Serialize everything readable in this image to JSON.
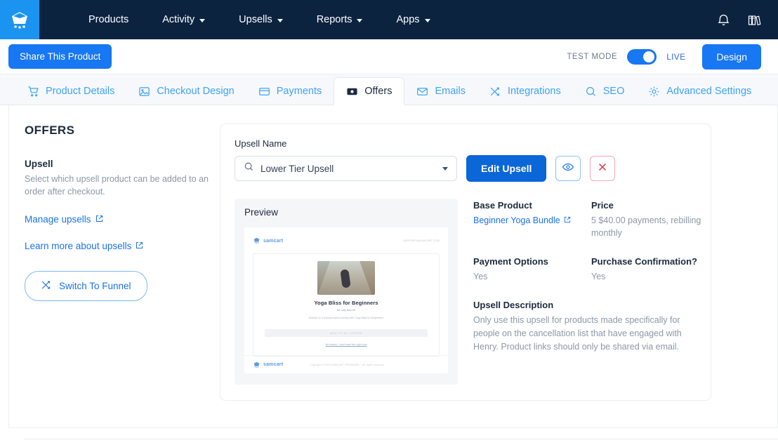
{
  "topnav": {
    "brand_icon": "samcart-logo-icon",
    "links": [
      {
        "label": "Products",
        "has_caret": false
      },
      {
        "label": "Activity",
        "has_caret": true
      },
      {
        "label": "Upsells",
        "has_caret": true
      },
      {
        "label": "Reports",
        "has_caret": true
      },
      {
        "label": "Apps",
        "has_caret": true
      }
    ],
    "notification_icon": "bell-icon",
    "library_icon": "books-icon"
  },
  "subbar": {
    "share_label": "Share This Product",
    "test_mode_label": "TEST MODE",
    "live_label": "LIVE",
    "toggle_on": true,
    "design_label": "Design"
  },
  "tabs": [
    {
      "label": "Product Details",
      "icon": "cart-icon",
      "active": false
    },
    {
      "label": "Checkout Design",
      "icon": "image-icon",
      "active": false
    },
    {
      "label": "Payments",
      "icon": "credit-card-icon",
      "active": false
    },
    {
      "label": "Offers",
      "icon": "offers-icon",
      "active": true
    },
    {
      "label": "Emails",
      "icon": "envelope-icon",
      "active": false
    },
    {
      "label": "Integrations",
      "icon": "shuffle-icon",
      "active": false
    },
    {
      "label": "SEO",
      "icon": "search-icon",
      "active": false
    },
    {
      "label": "Advanced Settings",
      "icon": "gear-icon",
      "active": false
    }
  ],
  "page": {
    "title": "OFFERS"
  },
  "sidebar": {
    "section_title": "Upsell",
    "section_desc": "Select which upsell product can be added to an order after checkout.",
    "manage_link": "Manage upsells",
    "learn_link": "Learn more about upsells",
    "switch_button": "Switch To Funnel"
  },
  "card": {
    "upsell_name_label": "Upsell Name",
    "selected_upsell": "Lower Tier Upsell",
    "edit_label": "Edit Upsell",
    "preview_icon": "eye-icon",
    "delete_icon": "close-x-icon",
    "search_icon": "search-icon"
  },
  "preview": {
    "title": "Preview",
    "logo_text": "samcart",
    "support_text": "SUPPORT@SAMCART.COM",
    "product_heading": "Yoga Bliss for Beginners",
    "product_price": "for only $34.00",
    "product_desc": "Embark on a transformative journey with 'Yoga Bliss for Beginners'!",
    "cta_label": "ADD TO MY ORDER",
    "decline_label": "No thanks, I don't want this right now",
    "footer_logo": "samcart",
    "footer_copy": "Copyright © 2023 SAMCART PRODIGIES – All rights reserved"
  },
  "details": {
    "base_product_label": "Base Product",
    "base_product_value": "Beginner Yoga Bundle",
    "price_label": "Price",
    "price_value": "5 $40.00 payments, rebilling monthly",
    "payment_options_label": "Payment Options",
    "payment_options_value": "Yes",
    "purchase_confirmation_label": "Purchase Confirmation?",
    "purchase_confirmation_value": "Yes",
    "upsell_description_label": "Upsell Description",
    "upsell_description_value": "Only use this upsell for products made specifically for people on the cancellation list that have engaged with Henry. Product links should only be shared via email."
  },
  "colors": {
    "nav_bg": "#0c2340",
    "brand_blue": "#1a94f0",
    "primary_blue": "#1877f2",
    "link_blue": "#1a73e8",
    "tab_blue": "#3fa3f5",
    "danger_red": "#e03b4c"
  }
}
